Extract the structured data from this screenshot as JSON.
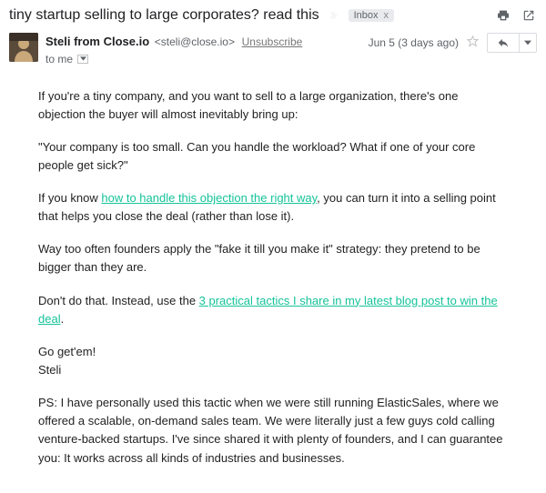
{
  "header": {
    "subject": "tiny startup selling to large corporates? read this",
    "label": "Inbox"
  },
  "meta": {
    "sender_name": "Steli from Close.io",
    "sender_email": "<steli@close.io>",
    "unsubscribe": "Unsubscribe",
    "to_line": "to me",
    "date": "Jun 5 (3 days ago)"
  },
  "body": {
    "p1": "If you're a tiny company, and you want to sell to a large organization, there's one objection the buyer will almost inevitably bring up:",
    "p2": "\"Your company is too small. Can you handle the workload? What if one of your core people get sick?\"",
    "p3a": "If you know ",
    "p3link": "how to handle this objection the right way",
    "p3b": ", you can turn it into a selling point that helps you close the deal (rather than lose it).",
    "p4": "Way too often founders apply the \"fake it till you make it\" strategy: they pretend to be bigger than they are.",
    "p5a": "Don't do that. Instead, use the ",
    "p5link": "3 practical tactics I share in my latest blog post to win the deal",
    "p5b": ".",
    "p6": "Go get'em!",
    "p7": "Steli",
    "p8": "PS: I have personally used this tactic when we were still running ElasticSales, where we offered a scalable, on-demand sales team. We were literally just a few guys cold calling venture-backed startups. I've since shared it with plenty of founders, and I can guarantee you: It works across all kinds of industries and businesses."
  }
}
